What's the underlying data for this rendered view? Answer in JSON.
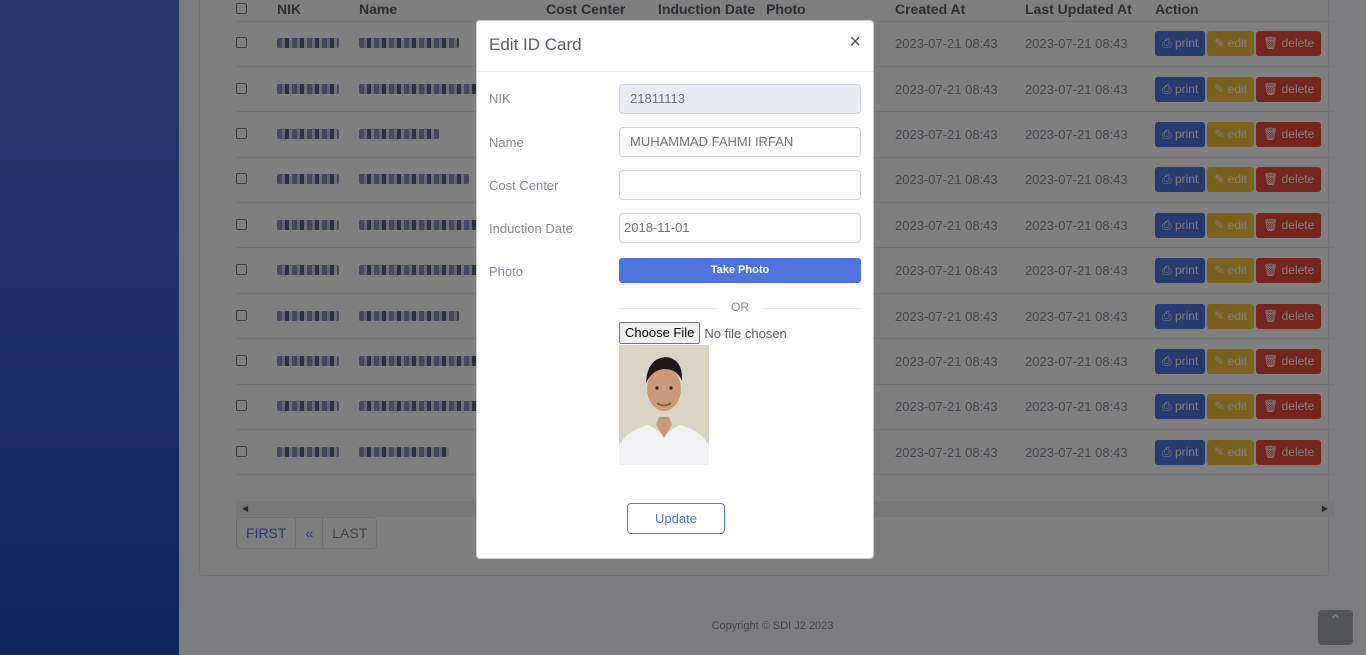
{
  "table": {
    "headers": [
      "NIK",
      "Name",
      "Cost Center",
      "Induction Date",
      "Photo",
      "Created At",
      "Last Updated At",
      "Action"
    ],
    "rows": [
      {
        "created": "2023-07-21 08:43",
        "updated": "2023-07-21 08:43"
      },
      {
        "created": "2023-07-21 08:43",
        "updated": "2023-07-21 08:43"
      },
      {
        "created": "2023-07-21 08:43",
        "updated": "2023-07-21 08:43"
      },
      {
        "created": "2023-07-21 08:43",
        "updated": "2023-07-21 08:43"
      },
      {
        "created": "2023-07-21 08:43",
        "updated": "2023-07-21 08:43"
      },
      {
        "created": "2023-07-21 08:43",
        "updated": "2023-07-21 08:43"
      },
      {
        "created": "2023-07-21 08:43",
        "updated": "2023-07-21 08:43"
      },
      {
        "created": "2023-07-21 08:43",
        "updated": "2023-07-21 08:43"
      },
      {
        "created": "2023-07-21 08:43",
        "updated": "2023-07-21 08:43"
      },
      {
        "created": "2023-07-21 08:43",
        "updated": "2023-07-21 08:43"
      }
    ],
    "actions": {
      "print": "print",
      "edit": "edit",
      "delete": "delete"
    }
  },
  "pager": {
    "first": "FIRST",
    "prev": "«",
    "last": "LAST"
  },
  "footer": "Copyright © SDI J2 2023",
  "modal": {
    "title": "Edit ID Card",
    "close": "×",
    "fields": {
      "nik": {
        "label": "NIK",
        "value": "21811113"
      },
      "name": {
        "label": "Name",
        "value": "MUHAMMAD FAHMI IRFAN"
      },
      "cost_center": {
        "label": "Cost Center",
        "value": ""
      },
      "induction_date": {
        "label": "Induction Date",
        "value": "2018-11-01"
      },
      "photo": {
        "label": "Photo"
      }
    },
    "take_photo": "Take Photo",
    "or": "OR",
    "choose_file": "Choose File",
    "no_file": "No file chosen",
    "update": "Update"
  },
  "colors": {
    "primary": "#4e73df",
    "warning": "#f6c23e",
    "danger": "#e74a3b"
  }
}
